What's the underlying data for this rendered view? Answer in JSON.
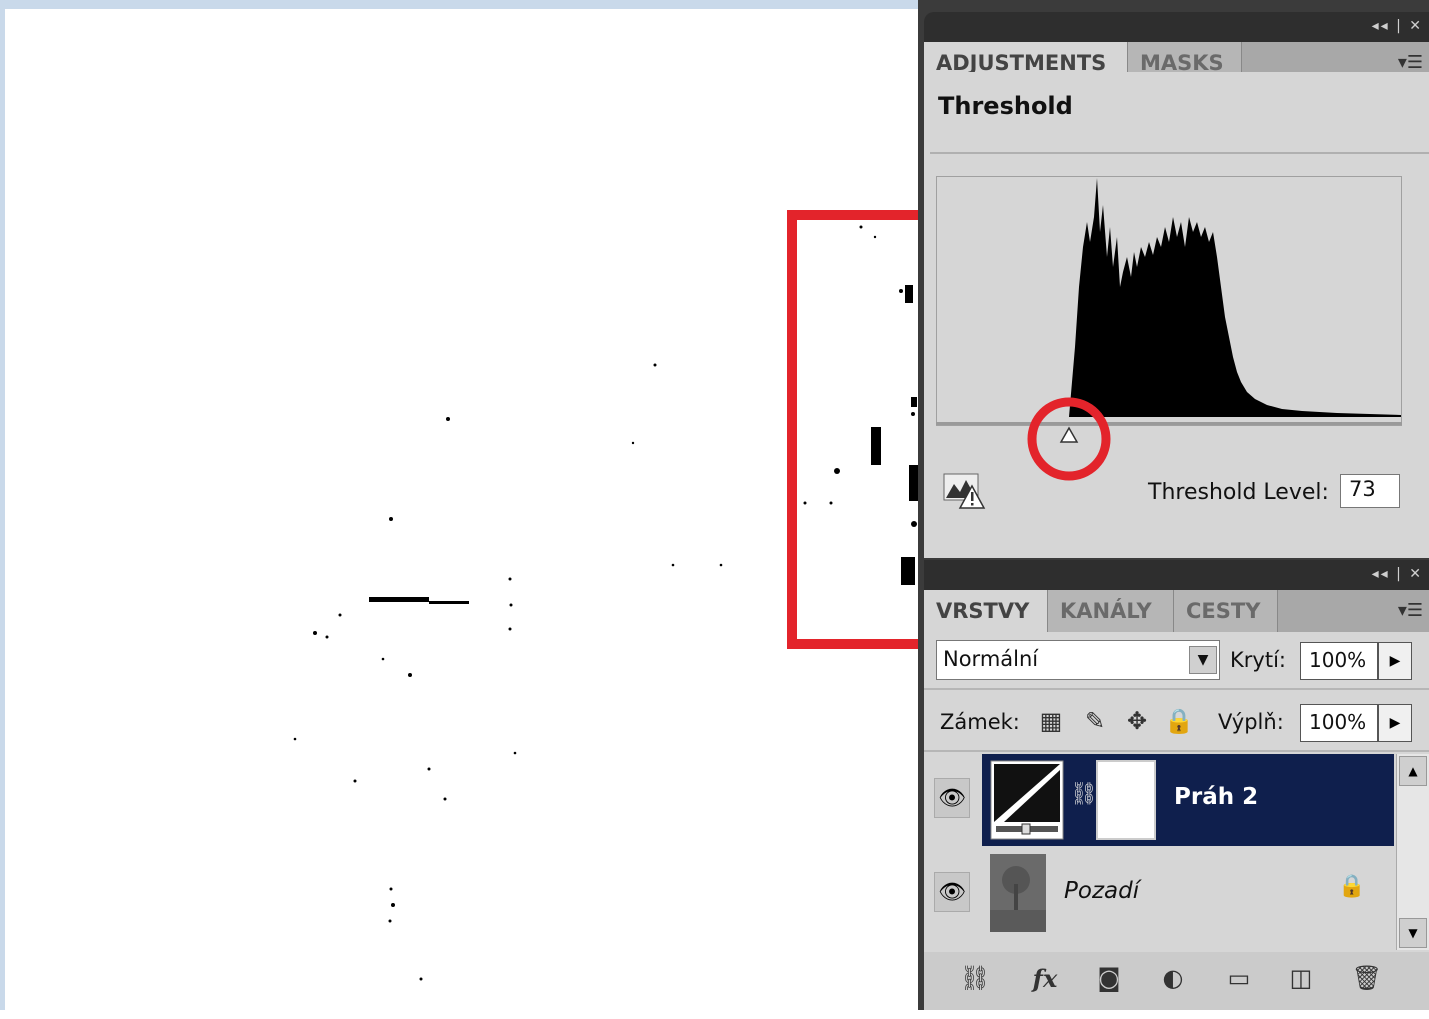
{
  "adjustments_panel": {
    "tabs": [
      "ADJUSTMENTS",
      "MASKS"
    ],
    "title": "Threshold",
    "threshold_label": "Threshold Level:",
    "threshold_value": "73",
    "threshold_fraction": 0.286
  },
  "layers_panel": {
    "tabs": [
      "VRSTVY",
      "KANÁLY",
      "CESTY"
    ],
    "blend_mode": "Normální",
    "opacity_label": "Krytí:",
    "opacity_value": "100%",
    "lock_label": "Zámek:",
    "fill_label": "Výplň:",
    "fill_value": "100%",
    "layers": [
      {
        "name": "Práh 2",
        "selected": true
      },
      {
        "name": "Pozadí",
        "selected": false,
        "locked": true
      }
    ]
  },
  "colors": {
    "highlight": "#e3242b",
    "selected_layer": "#0f1f4d",
    "panel_bg": "#d6d6d6"
  },
  "icons": [
    "eye-icon",
    "lock-icon",
    "link-icon",
    "fx-icon",
    "mask-icon",
    "adjustment-icon",
    "folder-icon",
    "new-layer-icon",
    "trash-icon",
    "warning-icon"
  ]
}
